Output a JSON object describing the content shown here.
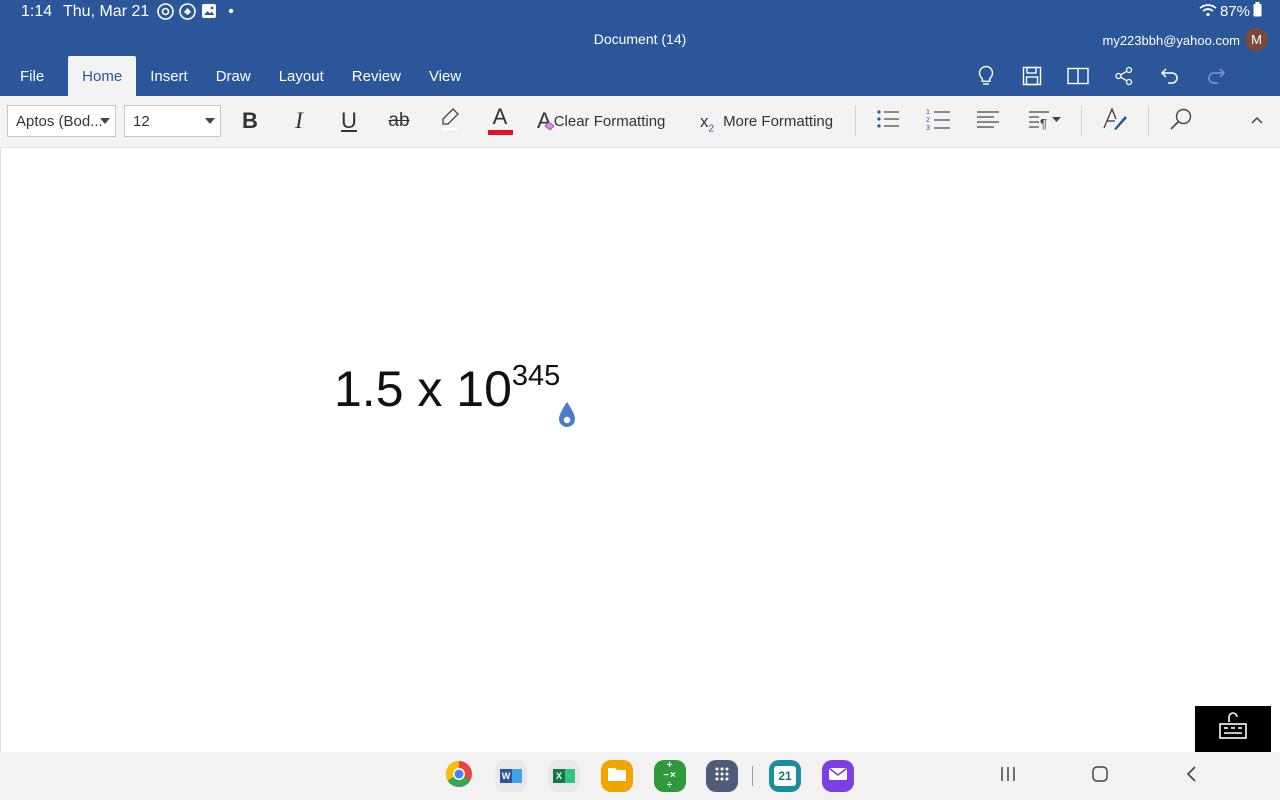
{
  "status_bar": {
    "time": "1:14",
    "date": "Thu, Mar 21",
    "battery": "87%",
    "icons": [
      "sync-icon",
      "location-icon",
      "image-icon",
      "dot-icon",
      "wifi-icon",
      "battery-icon"
    ]
  },
  "document_title": "Document (14)",
  "account": {
    "email": "my223bbh@yahoo.com",
    "avatar_initial": "M"
  },
  "tabs": [
    {
      "label": "File"
    },
    {
      "label": "Home",
      "active": true
    },
    {
      "label": "Insert"
    },
    {
      "label": "Draw"
    },
    {
      "label": "Layout"
    },
    {
      "label": "Review"
    },
    {
      "label": "View"
    }
  ],
  "top_actions": [
    "lightbulb-icon",
    "save-icon",
    "reading-view-icon",
    "share-icon",
    "undo-icon",
    "redo-icon"
  ],
  "ribbon": {
    "font_name": "Aptos (Bod...",
    "font_size": "12",
    "bold": "B",
    "italic": "I",
    "underline": "U",
    "strikethrough": "ab",
    "font_color_letter": "A",
    "clear_formatting": "Clear Formatting",
    "clear_formatting_glyph": "A",
    "subscript_glyph": "x",
    "subscript_sub": "2",
    "more_formatting": "More Formatting",
    "font_color": "#e81123",
    "icons": [
      "highlighter-icon",
      "bullets-icon",
      "numbering-icon",
      "align-icon",
      "paragraph-icon",
      "styles-icon",
      "search-icon",
      "collapse-ribbon-icon"
    ]
  },
  "document": {
    "equation_base": "1.5 x 10",
    "equation_exponent": "345"
  },
  "dock": {
    "apps": [
      "chrome-icon",
      "word-icon",
      "excel-icon",
      "files-icon",
      "calculator-icon",
      "app-drawer-icon",
      "calendar-icon",
      "email-icon"
    ],
    "calendar_day": "21",
    "word_letter": "W",
    "excel_letter": "X",
    "calculator_symbols": "+−×÷"
  },
  "colors": {
    "brand_blue": "#2b579a",
    "ribbon_bg": "#f3f3f3",
    "accent_cursor": "#4a7cc9"
  }
}
